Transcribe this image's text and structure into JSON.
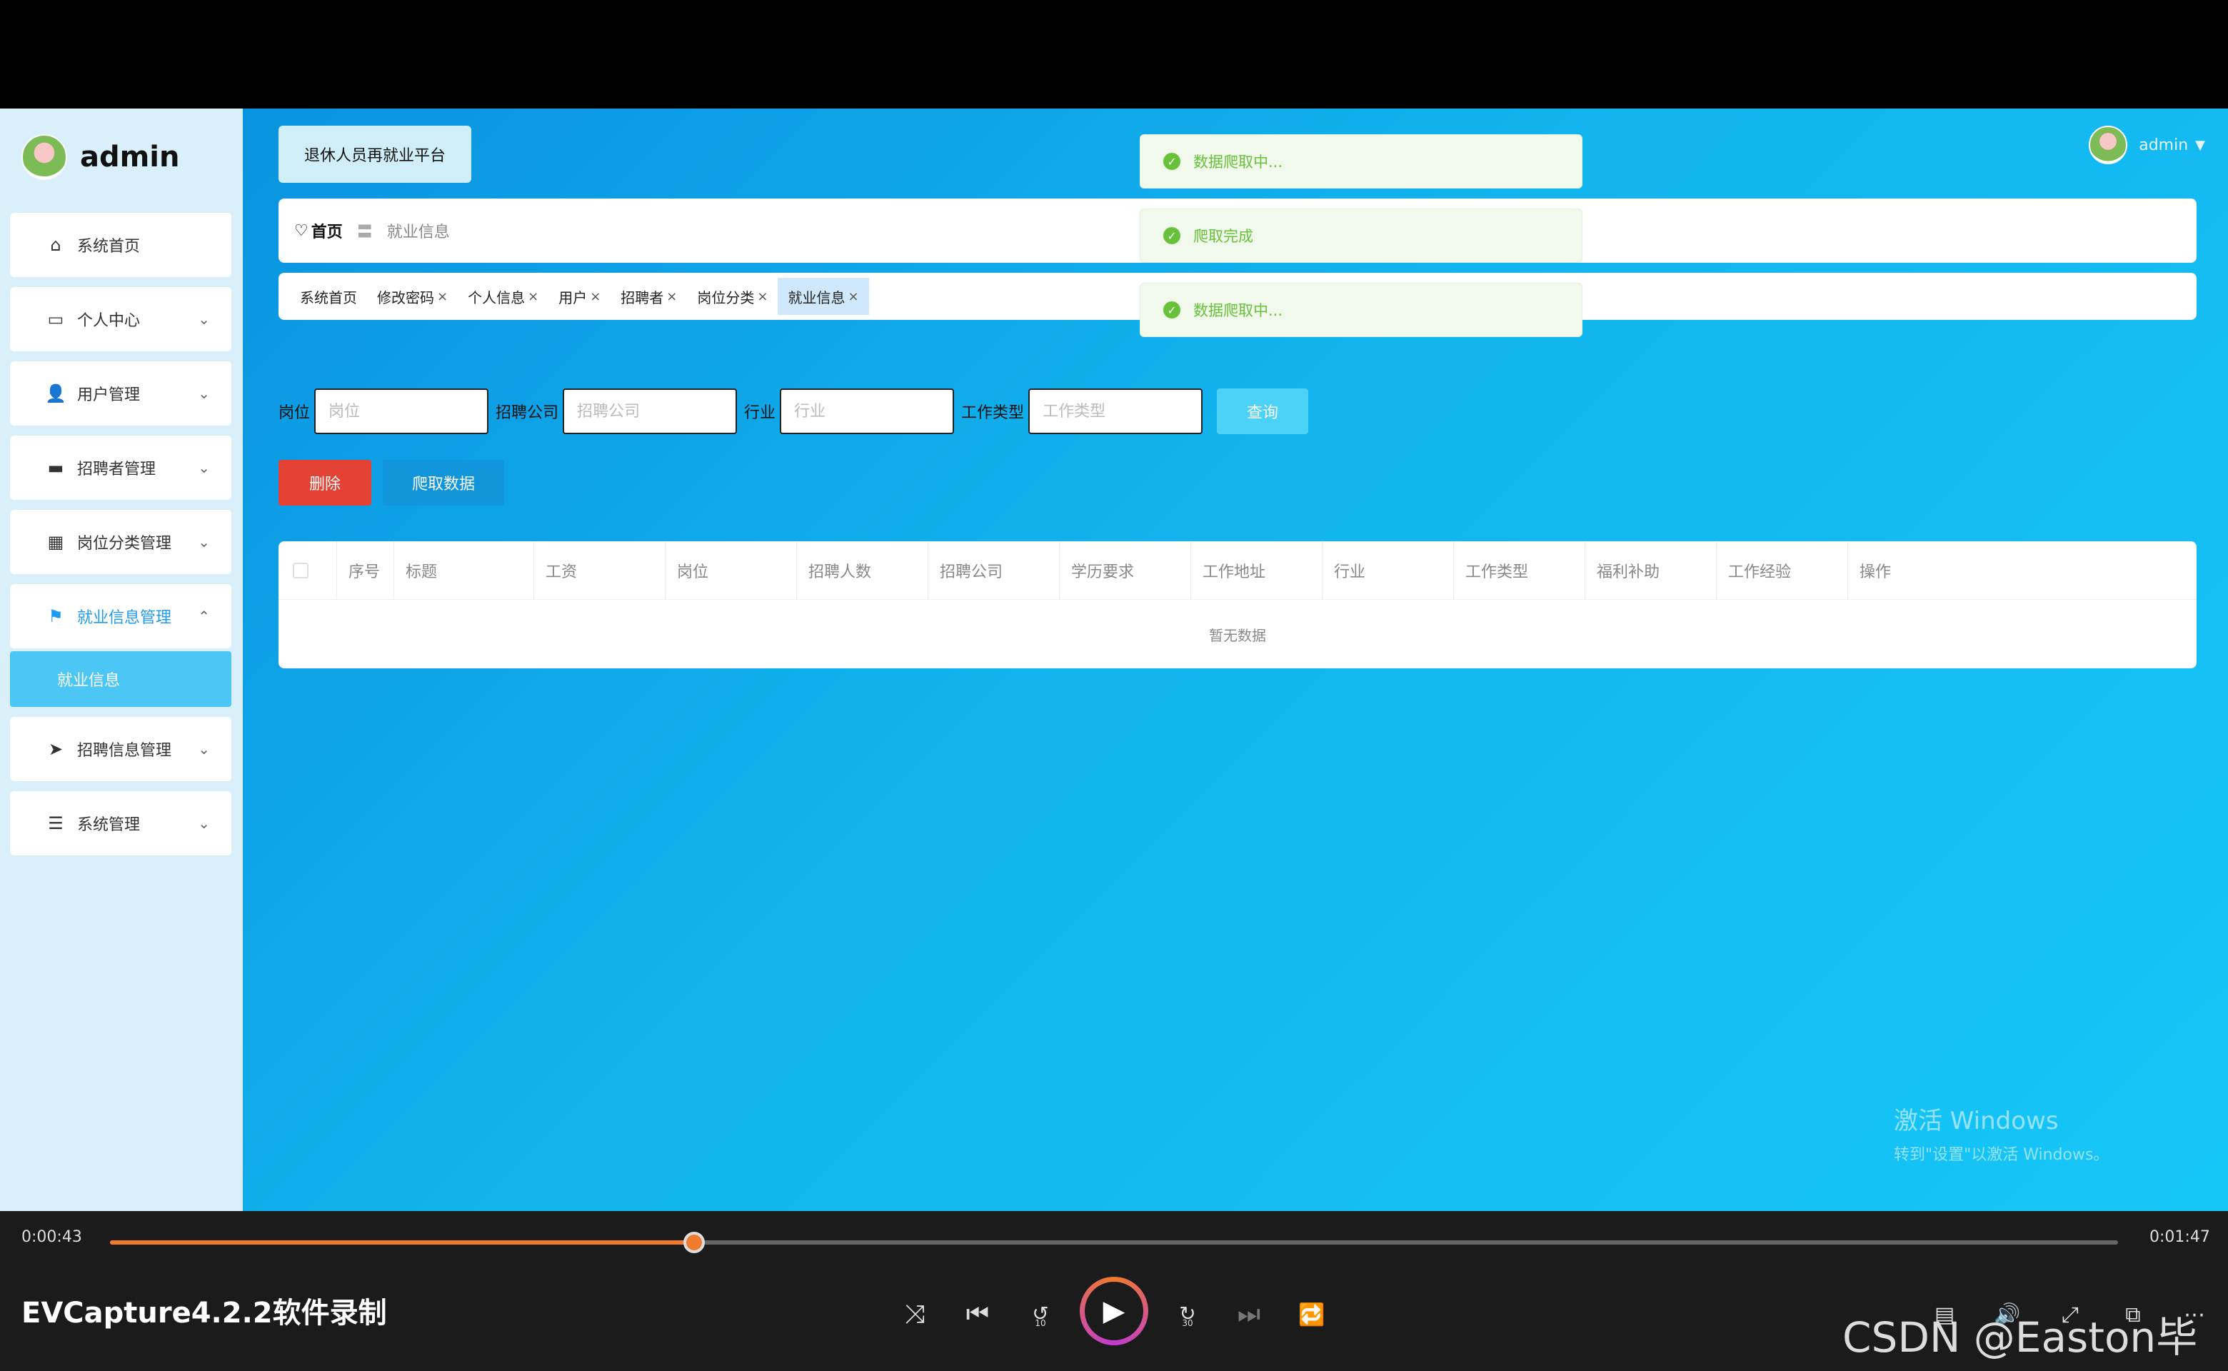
{
  "brand": {
    "name": "admin"
  },
  "sidebar": {
    "items": [
      {
        "label": "系统首页",
        "icon": "home-icon",
        "glyph": "⌂",
        "has_children": false,
        "active": false
      },
      {
        "label": "个人中心",
        "icon": "card-icon",
        "glyph": "▭",
        "has_children": true,
        "active": false
      },
      {
        "label": "用户管理",
        "icon": "user-icon",
        "glyph": "👤",
        "has_children": true,
        "active": false
      },
      {
        "label": "招聘者管理",
        "icon": "monitor-icon",
        "glyph": "▬",
        "has_children": true,
        "active": false
      },
      {
        "label": "岗位分类管理",
        "icon": "grid-icon",
        "glyph": "▦",
        "has_children": true,
        "active": false
      },
      {
        "label": "就业信息管理",
        "icon": "flag-icon",
        "glyph": "⚑",
        "has_children": true,
        "active": true
      },
      {
        "label": "招聘信息管理",
        "icon": "send-icon",
        "glyph": "➤",
        "has_children": true,
        "active": false
      },
      {
        "label": "系统管理",
        "icon": "sliders-icon",
        "glyph": "☰",
        "has_children": true,
        "active": false
      }
    ],
    "submenu_label": "就业信息",
    "chevron_down": "⌄",
    "chevron_up": "⌃"
  },
  "header": {
    "system_title": "退休人员再就业平台",
    "user_name": "admin",
    "caret": "▼"
  },
  "breadcrumb": {
    "home_icon": "♡",
    "home": "首页",
    "separator": "〓",
    "current": "就业信息"
  },
  "tabs": [
    {
      "label": "系统首页",
      "closable": false,
      "active": false
    },
    {
      "label": "修改密码",
      "closable": true,
      "active": false
    },
    {
      "label": "个人信息",
      "closable": true,
      "active": false
    },
    {
      "label": "用户",
      "closable": true,
      "active": false
    },
    {
      "label": "招聘者",
      "closable": true,
      "active": false
    },
    {
      "label": "岗位分类",
      "closable": true,
      "active": false
    },
    {
      "label": "就业信息",
      "closable": true,
      "active": true
    }
  ],
  "tab_close_glyph": "×",
  "toasts": [
    {
      "message": "数据爬取中..."
    },
    {
      "message": "爬取完成"
    },
    {
      "message": "数据爬取中..."
    }
  ],
  "toast_icon_glyph": "✓",
  "search": {
    "fields": [
      {
        "label": "岗位",
        "placeholder": "岗位",
        "value": ""
      },
      {
        "label": "招聘公司",
        "placeholder": "招聘公司",
        "value": ""
      },
      {
        "label": "行业",
        "placeholder": "行业",
        "value": ""
      },
      {
        "label": "工作类型",
        "placeholder": "工作类型",
        "value": ""
      }
    ],
    "button_label": "查询"
  },
  "actions": {
    "delete_label": "删除",
    "crawl_label": "爬取数据"
  },
  "table": {
    "columns": [
      "序号",
      "标题",
      "工资",
      "岗位",
      "招聘人数",
      "招聘公司",
      "学历要求",
      "工作地址",
      "行业",
      "工作类型",
      "福利补助",
      "工作经验",
      "操作"
    ],
    "empty_text": "暂无数据"
  },
  "watermark": {
    "line1": "激活 Windows",
    "line2": "转到\"设置\"以激活 Windows。"
  },
  "player": {
    "current_time": "0:00:43",
    "total_time": "0:01:47",
    "progress_percent": 29.1,
    "recorder_label": "EVCapture4.2.2软件录制",
    "controls": {
      "shuffle": "⤨",
      "prev": "⏮",
      "rewind": "↺",
      "rewind_num": "10",
      "play": "▶",
      "forward": "↻",
      "forward_num": "30",
      "next": "⏭",
      "repeat": "🔁",
      "subtitle": "▤",
      "volume": "🔊",
      "fullscreen": "⤢",
      "pip": "⧉",
      "more": "⋯"
    },
    "site_watermark": "CSDN @Easton毕设"
  },
  "colors": {
    "accent": "#1e9bf0",
    "delete": "#e34234",
    "crawl": "#1296db",
    "search": "#4cd2f7",
    "success": "#67c23a",
    "progress": "#f07a2e"
  }
}
